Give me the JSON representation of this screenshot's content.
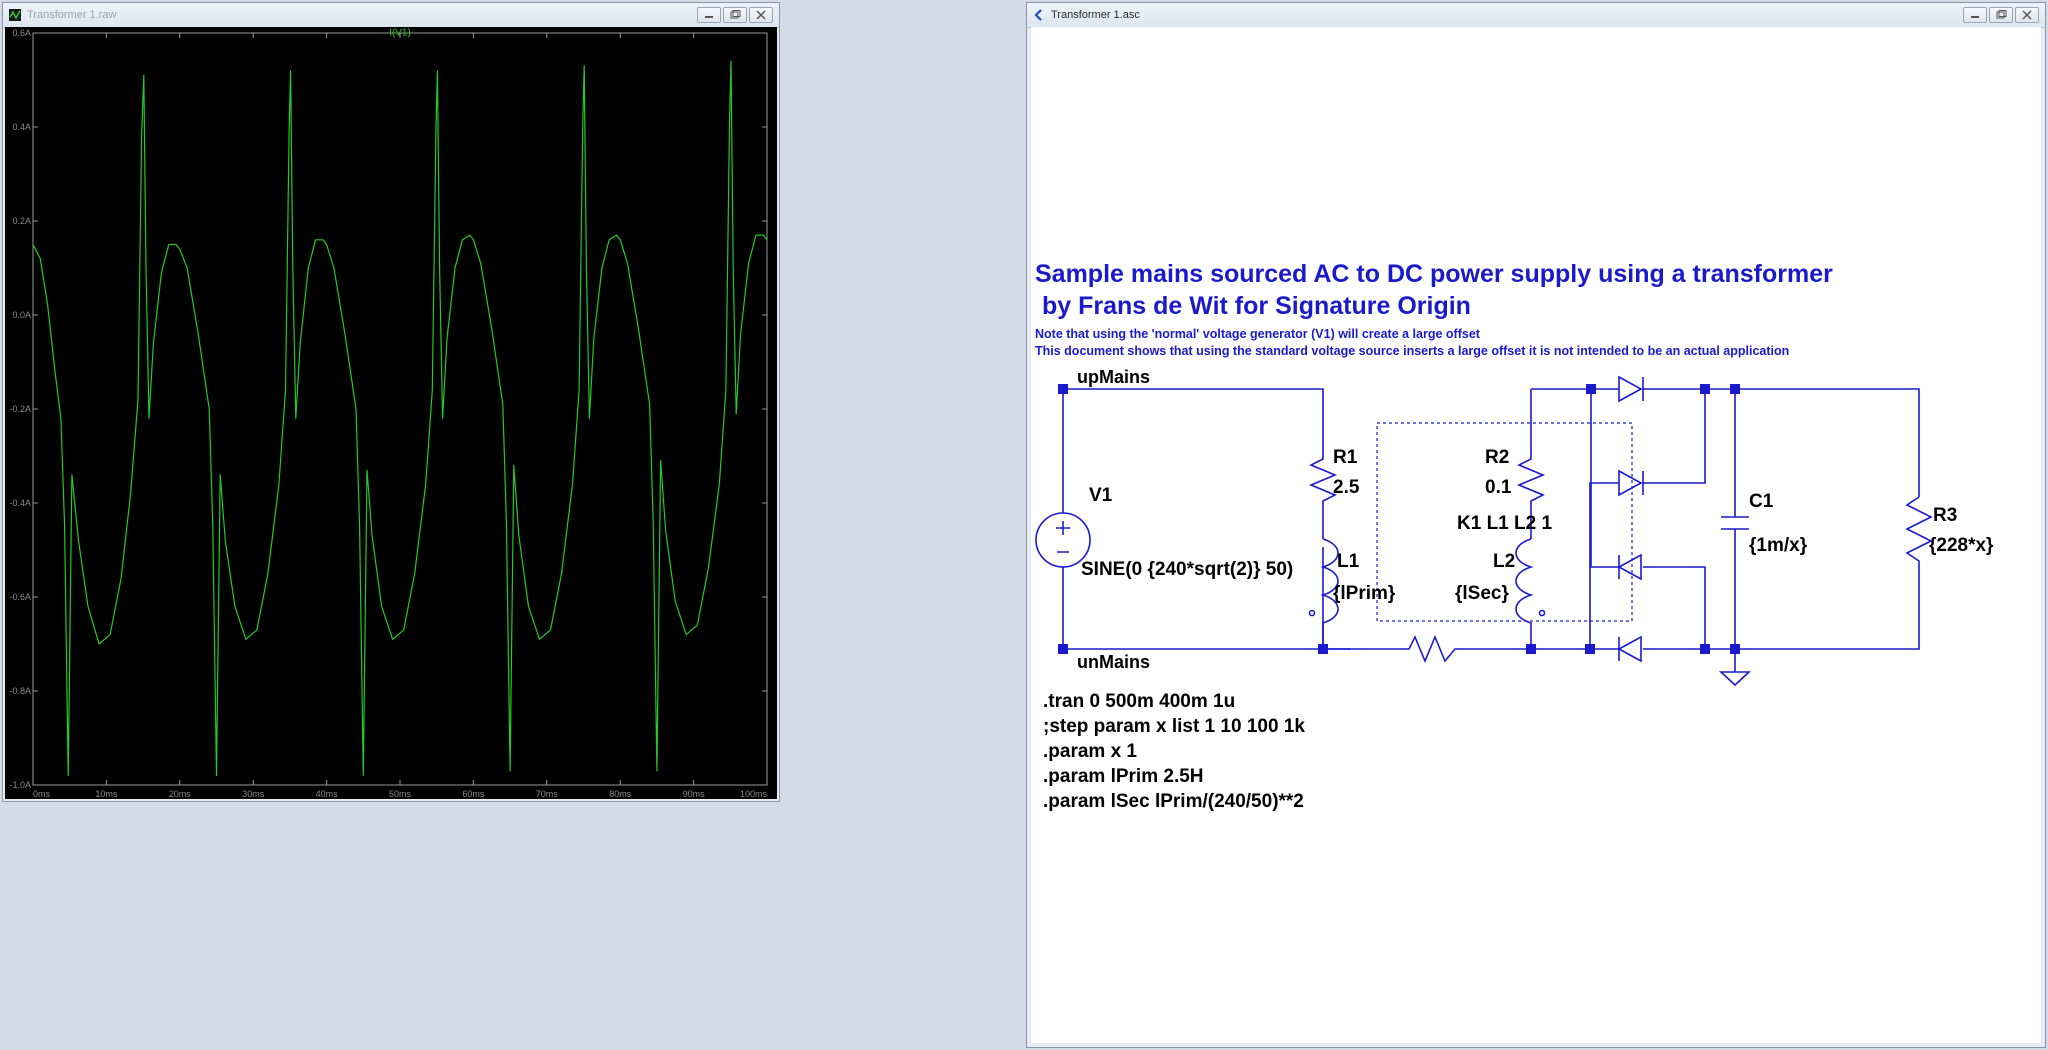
{
  "plot_window": {
    "title": "Transformer 1.raw",
    "trace_label": "I(V1)",
    "trace_color": "#22cc22",
    "background": "#000000",
    "axis_text_color": "#8a8a8a",
    "y_ticks": [
      "0.6A",
      "0.4A",
      "0.2A",
      "0.0A",
      "-0.2A",
      "-0.4A",
      "-0.6A",
      "-0.8A",
      "-1.0A"
    ],
    "x_ticks": [
      "0ms",
      "10ms",
      "20ms",
      "30ms",
      "40ms",
      "50ms",
      "60ms",
      "70ms",
      "80ms",
      "90ms",
      "100ms"
    ]
  },
  "chart_data": {
    "type": "line",
    "title": "I(V1)",
    "xlabel": "",
    "ylabel": "",
    "x_unit": "ms",
    "y_unit": "A",
    "xlim": [
      0,
      100
    ],
    "ylim": [
      -1.0,
      0.6
    ],
    "grid": false,
    "series": [
      {
        "name": "I(V1)",
        "x": [
          0,
          1,
          2,
          3,
          3.8,
          4.3,
          4.8,
          5.3,
          6.2,
          7.5,
          9,
          10.5,
          12,
          13.3,
          14.3,
          14.8,
          15.1,
          15.4,
          15.8,
          16.4,
          17.5,
          18.5,
          19.5,
          20,
          21,
          22.5,
          24,
          24.5,
          25,
          25.5,
          26.2,
          27.5,
          29,
          30.5,
          32,
          33.5,
          34.4,
          34.9,
          35.1,
          35.4,
          35.8,
          36.4,
          37.5,
          38.5,
          39.5,
          40,
          41,
          42.5,
          44,
          44.5,
          45,
          45.5,
          46.2,
          47.5,
          49,
          50.5,
          52,
          53.5,
          54.4,
          54.9,
          55.1,
          55.4,
          55.8,
          56.4,
          57.5,
          58.5,
          59.5,
          60,
          61,
          62.5,
          64,
          64.5,
          65,
          65.5,
          66.2,
          67.5,
          69,
          70.5,
          72,
          73.5,
          74.4,
          74.9,
          75.1,
          75.4,
          75.8,
          76.4,
          77.5,
          78.5,
          79.5,
          80,
          81,
          82.5,
          84,
          84.5,
          85,
          85.5,
          86.2,
          87.5,
          89,
          90.5,
          92,
          93.5,
          94.4,
          94.9,
          95.1,
          95.4,
          95.8,
          96.4,
          97.5,
          98.5,
          99.5,
          100
        ],
        "y": [
          0.15,
          0.12,
          0.02,
          -0.12,
          -0.22,
          -0.45,
          -0.98,
          -0.34,
          -0.48,
          -0.62,
          -0.7,
          -0.68,
          -0.56,
          -0.38,
          -0.18,
          0.38,
          0.51,
          0.1,
          -0.22,
          -0.06,
          0.09,
          0.15,
          0.15,
          0.14,
          0.1,
          -0.04,
          -0.2,
          -0.45,
          -0.98,
          -0.34,
          -0.48,
          -0.62,
          -0.69,
          -0.67,
          -0.55,
          -0.36,
          -0.16,
          0.4,
          0.52,
          0.1,
          -0.22,
          -0.06,
          0.1,
          0.16,
          0.16,
          0.15,
          0.1,
          -0.04,
          -0.2,
          -0.45,
          -0.98,
          -0.33,
          -0.47,
          -0.62,
          -0.69,
          -0.67,
          -0.55,
          -0.36,
          -0.16,
          0.4,
          0.52,
          0.1,
          -0.22,
          -0.05,
          0.1,
          0.16,
          0.17,
          0.16,
          0.11,
          -0.03,
          -0.19,
          -0.44,
          -0.97,
          -0.32,
          -0.47,
          -0.62,
          -0.69,
          -0.67,
          -0.55,
          -0.36,
          -0.16,
          0.41,
          0.53,
          0.1,
          -0.22,
          -0.05,
          0.1,
          0.16,
          0.17,
          0.16,
          0.11,
          -0.03,
          -0.19,
          -0.44,
          -0.97,
          -0.31,
          -0.46,
          -0.61,
          -0.68,
          -0.66,
          -0.54,
          -0.36,
          -0.16,
          0.42,
          0.54,
          0.1,
          -0.21,
          -0.04,
          0.11,
          0.17,
          0.17,
          0.16
        ]
      }
    ]
  },
  "schematic_window": {
    "title": "Transformer 1.asc",
    "wire_color": "#1a1acc",
    "text_color": "#1a1acc",
    "comp_text_color": "#000000",
    "heading_line1": "Sample mains sourced AC to DC power supply using a transformer",
    "heading_line2": " by Frans de Wit for Signature Origin",
    "note1": "Note that using the 'normal' voltage generator (V1) will create a large offset",
    "note2": "This document shows that using the standard voltage source inserts a large offset it is not intended to be an actual application",
    "net_up": "upMains",
    "net_un": "unMains",
    "v1_name": "V1",
    "v1_value": "SINE(0 {240*sqrt(2)} 50)",
    "r1_name": "R1",
    "r1_value": "2.5",
    "r2_name": "R2",
    "r2_value": "0.1",
    "coupling": "K1 L1 L2 1",
    "l1_name": "L1",
    "l1_value": "{lPrim}",
    "l2_name": "L2",
    "l2_value": "{lSec}",
    "c1_name": "C1",
    "c1_value": "{1m/x}",
    "r3_name": "R3",
    "r3_value": "{228*x}",
    "directives": [
      ".tran 0 500m 400m 1u",
      ";step param x list 1 10 100 1k",
      ".param x 1",
      ".param lPrim 2.5H",
      ".param lSec lPrim/(240/50)**2"
    ]
  }
}
